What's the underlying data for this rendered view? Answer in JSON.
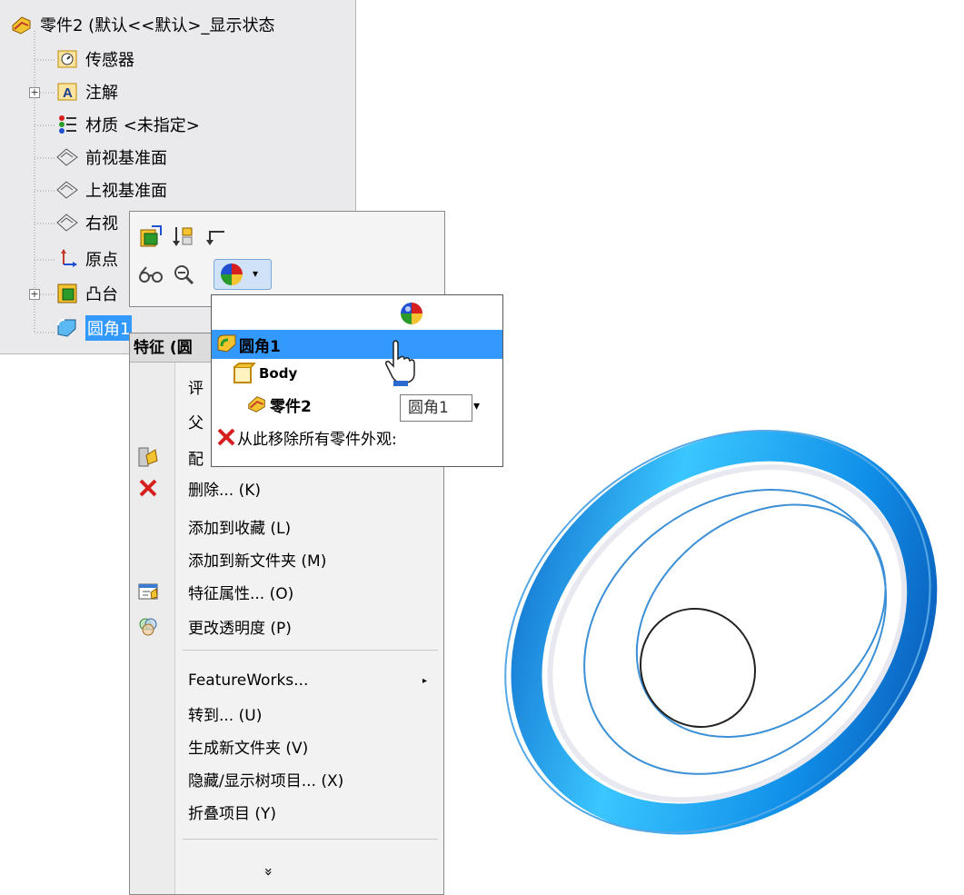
{
  "tree": {
    "root": "零件2  (默认<<默认>_显示状态",
    "items": [
      {
        "label": "传感器",
        "icon": "sensor-icon"
      },
      {
        "label": "注解",
        "icon": "annotation-icon"
      },
      {
        "label": "材质 <未指定>",
        "icon": "material-icon"
      },
      {
        "label": "前视基准面",
        "icon": "plane-icon"
      },
      {
        "label": "上视基准面",
        "icon": "plane-icon"
      },
      {
        "label": "右视",
        "icon": "plane-icon"
      },
      {
        "label": "原点",
        "icon": "origin-icon"
      },
      {
        "label": "凸台",
        "icon": "boss-icon"
      },
      {
        "label": "圆角1",
        "icon": "fillet-icon"
      }
    ]
  },
  "context_menu": {
    "header": "特征 (圆",
    "items": [
      {
        "label": "评",
        "icon": ""
      },
      {
        "label": "父",
        "icon": ""
      },
      {
        "label": "配",
        "icon": "configure-icon"
      },
      {
        "label": "删除... (K)",
        "icon": "delete-icon"
      },
      {
        "label": "添加到收藏 (L)",
        "icon": ""
      },
      {
        "label": "添加到新文件夹 (M)",
        "icon": ""
      },
      {
        "label": "特征属性... (O)",
        "icon": "properties-icon"
      },
      {
        "label": "更改透明度 (P)",
        "icon": "transparency-icon"
      },
      {
        "label": "FeatureWorks...",
        "icon": "",
        "submenu": true
      },
      {
        "label": "转到... (U)",
        "icon": ""
      },
      {
        "label": "生成新文件夹 (V)",
        "icon": ""
      },
      {
        "label": "隐藏/显示树项目... (X)",
        "icon": ""
      },
      {
        "label": "折叠项目 (Y)",
        "icon": ""
      }
    ],
    "expand_glyph": "»"
  },
  "appearance_dropdown": {
    "items": [
      {
        "label": "圆角1",
        "bold": true
      },
      {
        "label": "Body",
        "bold": true
      },
      {
        "label": "零件2",
        "bold": true
      },
      {
        "label": "从此移除所有零件外观:",
        "bold": false
      }
    ]
  },
  "tooltip": "圆角1",
  "colors": {
    "selection": "#3399ff",
    "ring_blue": "#1aa3e8",
    "delete_red": "#d62020"
  }
}
